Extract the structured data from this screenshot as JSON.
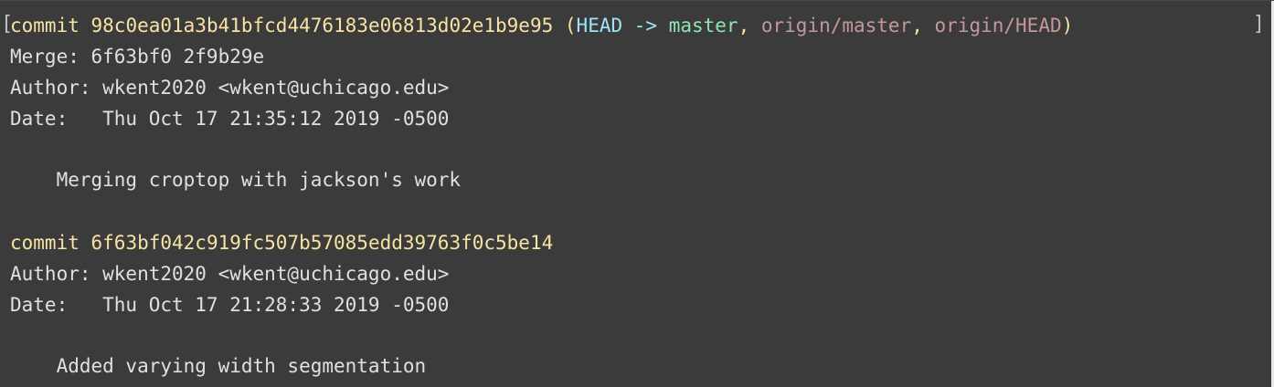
{
  "terminal": {
    "colors": {
      "background": "#3b3b3b",
      "text": "#e0e0e0",
      "commit_hash": "#f7e3a3",
      "head": "#9fe4f4",
      "branch_local": "#8fe3b5",
      "branch_remote": "#c4989a"
    },
    "commits": [
      {
        "commit_label": "commit ",
        "hash": "98c0ea01a3b41bfcd4476183e06813d02e1b9e95",
        "refs_open": " (",
        "head_ref": "HEAD -> ",
        "branch": "master",
        "sep1": ", ",
        "remote1": "origin/master",
        "sep2": ", ",
        "remote2": "origin/HEAD",
        "refs_close": ")",
        "merge_line": "Merge: 6f63bf0 2f9b29e",
        "author_line": "Author: wkent2020 <wkent@uchicago.edu>",
        "date_line": "Date:   Thu Oct 17 21:35:12 2019 -0500",
        "message": "    Merging croptop with jackson's work"
      },
      {
        "commit_label": "commit ",
        "hash": "6f63bf042c919fc507b57085edd39763f0c5be14",
        "author_line": "Author: wkent2020 <wkent@uchicago.edu>",
        "date_line": "Date:   Thu Oct 17 21:28:33 2019 -0500",
        "message": "    Added varying width segmentation"
      }
    ],
    "left_bracket": "[",
    "right_bracket": "]"
  }
}
